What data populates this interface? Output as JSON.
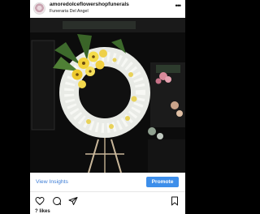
{
  "post": {
    "username": "amoredolceflowershopfunerals",
    "location": "Funeraria Del Angel",
    "more_icon": "more-horizontal-icon",
    "likes_partial": "? likes"
  },
  "insights": {
    "view_label": "View Insights",
    "promote_label": "Promote"
  },
  "actions": {
    "like_icon": "heart-icon",
    "comment_icon": "comment-icon",
    "share_icon": "send-icon",
    "save_icon": "bookmark-icon"
  },
  "colors": {
    "link_blue": "#3a7bd5",
    "promote_blue": "#3d8eea",
    "background": "#000000"
  }
}
